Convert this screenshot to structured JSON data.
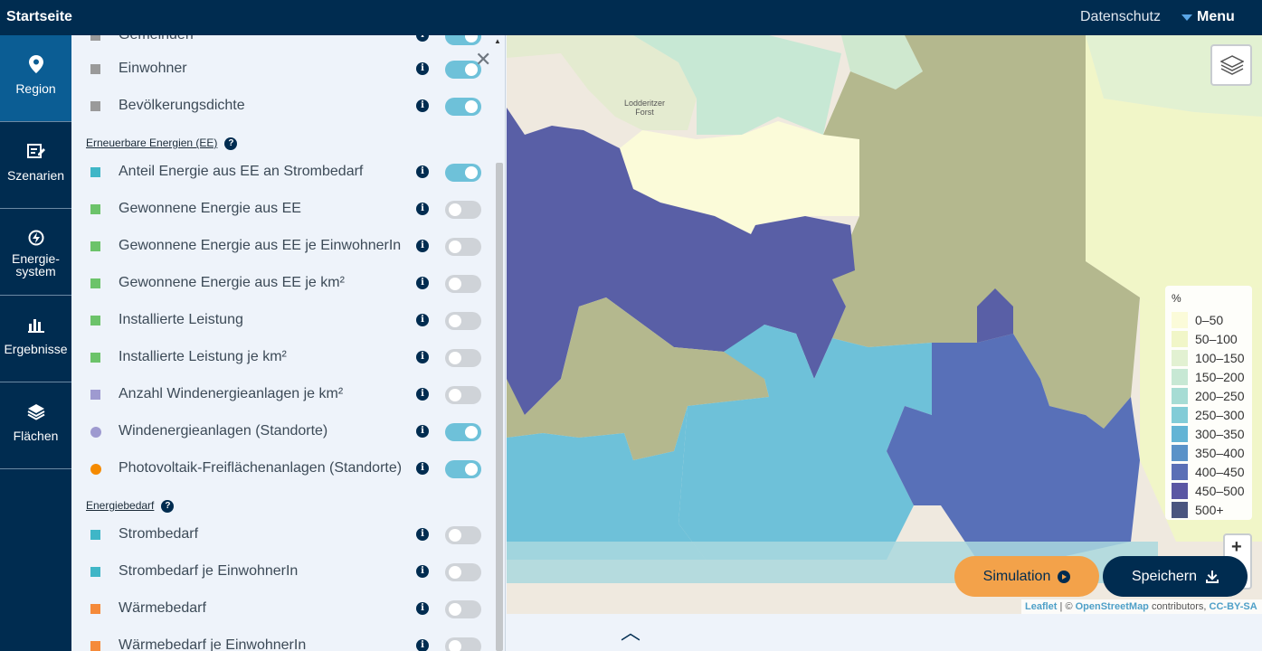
{
  "header": {
    "brand": "Startseite",
    "datenschutz": "Datenschutz",
    "menu": "Menu"
  },
  "nav": [
    {
      "label": "Region",
      "icon": "map-pin-icon"
    },
    {
      "label": "Szenarien",
      "icon": "edit-icon"
    },
    {
      "label": "Energie-\nsystem",
      "icon": "energy-icon"
    },
    {
      "label": "Ergebnisse",
      "icon": "bar-chart-icon"
    },
    {
      "label": "Flächen",
      "icon": "layers-icon"
    }
  ],
  "panel": {
    "rows_top": [
      {
        "label": "Gemeinden",
        "color": "#9a9a9a",
        "on": true
      },
      {
        "label": "Einwohner",
        "color": "#9a9a9a",
        "on": true
      },
      {
        "label": "Bevölkerungsdichte",
        "color": "#9a9a9a",
        "on": true
      }
    ],
    "section_ee": "Erneuerbare Energien (EE)",
    "rows_ee": [
      {
        "label": "Anteil Energie aus EE an Strombedarf",
        "color": "#3fb6c7",
        "shape": "square",
        "on": true
      },
      {
        "label": "Gewonnene Energie aus EE",
        "color": "#6cc36a",
        "shape": "square",
        "on": false
      },
      {
        "label": "Gewonnene Energie aus EE je EinwohnerIn",
        "color": "#6cc36a",
        "shape": "square",
        "on": false
      },
      {
        "label": "Gewonnene Energie aus EE je km²",
        "color": "#6cc36a",
        "shape": "square",
        "on": false
      },
      {
        "label": "Installierte Leistung",
        "color": "#6cc36a",
        "shape": "square",
        "on": false
      },
      {
        "label": "Installierte Leistung je km²",
        "color": "#6cc36a",
        "shape": "square",
        "on": false
      },
      {
        "label": "Anzahl Windenergieanlagen je km²",
        "color": "#9e9ad0",
        "shape": "square",
        "on": false
      },
      {
        "label": "Windenergieanlagen (Standorte)",
        "color": "#9e9ad0",
        "shape": "circle",
        "on": true
      },
      {
        "label": "Photovoltaik-Freiflächenanlagen (Standorte)",
        "color": "#f58a00",
        "shape": "circle",
        "on": true
      }
    ],
    "section_bedarf": "Energiebedarf",
    "rows_bedarf": [
      {
        "label": "Strombedarf",
        "color": "#3fb6c7",
        "shape": "square",
        "on": false
      },
      {
        "label": "Strombedarf je EinwohnerIn",
        "color": "#3fb6c7",
        "shape": "square",
        "on": false
      },
      {
        "label": "Wärmebedarf",
        "color": "#f58a3a",
        "shape": "square",
        "on": false
      },
      {
        "label": "Wärmebedarf je EinwohnerIn",
        "color": "#f58a3a",
        "shape": "square",
        "on": false
      }
    ]
  },
  "map": {
    "place_label": "Lodderitzer\nForst",
    "legend_unit": "%",
    "legend": [
      {
        "label": "0–50",
        "color": "#fbfbd9"
      },
      {
        "label": "50–100",
        "color": "#f1f6c8"
      },
      {
        "label": "100–150",
        "color": "#e2f1d2"
      },
      {
        "label": "150–200",
        "color": "#c7e8d4"
      },
      {
        "label": "200–250",
        "color": "#a6dcd4"
      },
      {
        "label": "250–300",
        "color": "#82ccd7"
      },
      {
        "label": "300–350",
        "color": "#63b4d5"
      },
      {
        "label": "350–400",
        "color": "#5a92c8"
      },
      {
        "label": "400–450",
        "color": "#5a6fb6"
      },
      {
        "label": "450–500",
        "color": "#5a56a3"
      },
      {
        "label": "500+",
        "color": "#4a5580"
      }
    ],
    "zoom_in": "+",
    "attribution_leaflet": "Leaflet",
    "attribution_sep": " | © ",
    "attribution_osm": "OpenStreetMap",
    "attribution_contrib": " contributors, ",
    "attribution_license": "CC-BY-SA"
  },
  "buttons": {
    "simulation": "Simulation",
    "speichern": "Speichern"
  }
}
